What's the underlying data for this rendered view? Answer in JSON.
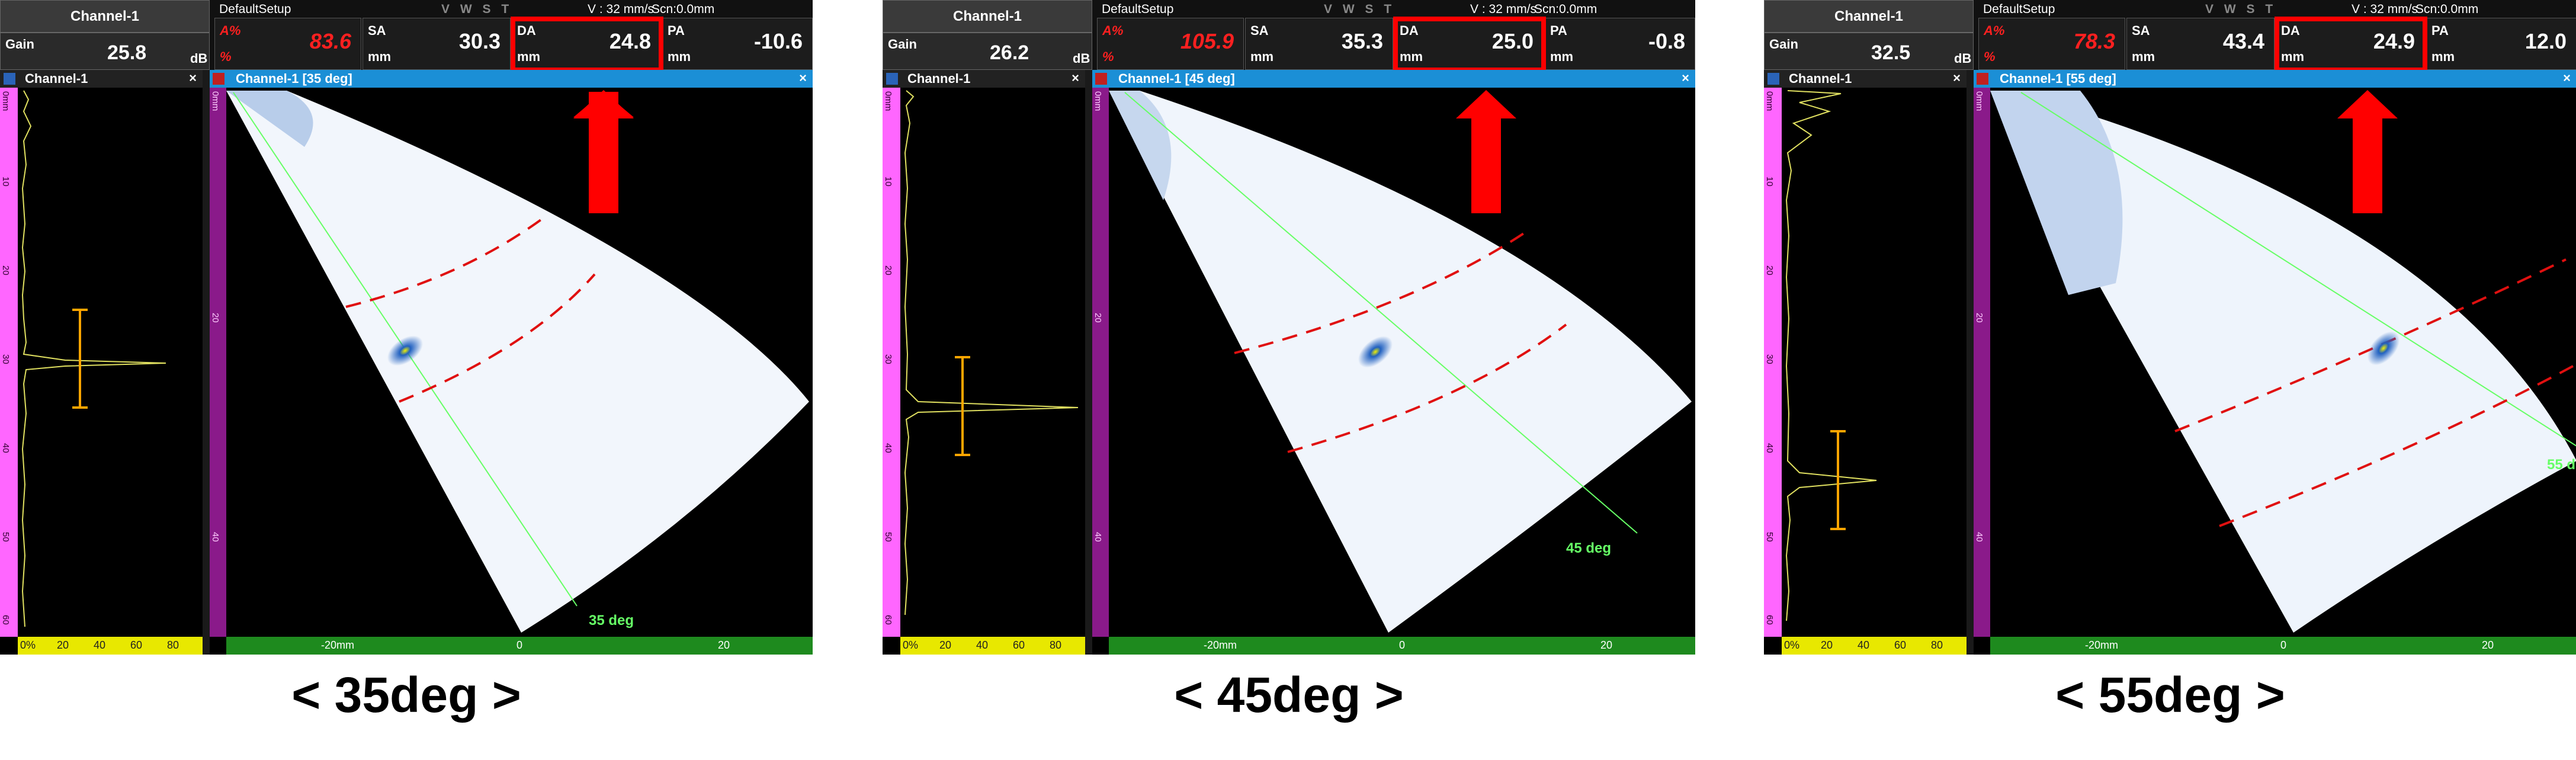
{
  "panels": [
    {
      "channel": "Channel-1",
      "gain_label": "Gain",
      "gain": "25.8",
      "gain_unit": "dB",
      "setup": "DefaultSetup",
      "vwst": "V W S T",
      "velocity": "V : 32 mm/s",
      "scan": "Scn:0.0mm",
      "ap_label": "A%",
      "ap_unit": "%",
      "ap_value": "83.6",
      "sa_label": "SA",
      "sa_unit": "mm",
      "sa_value": "30.3",
      "da_label": "DA",
      "da_unit": "mm",
      "da_value": "24.8",
      "pa_label": "PA",
      "pa_unit": "mm",
      "pa_value": "-10.6",
      "ascan_title": "Channel-1",
      "sector_title": "Channel-1 [35 deg]",
      "angle_label": "35 deg",
      "caption": "< 35deg >",
      "ruler_labels": [
        "0mm",
        "10",
        "20",
        "30",
        "40",
        "50",
        "60"
      ],
      "ascan_scale": [
        "0%",
        "20",
        "40",
        "60",
        "80"
      ],
      "sector_ruler": [
        "0mm",
        "20",
        "40"
      ],
      "gscale": [
        "-20mm",
        "0",
        "20"
      ]
    },
    {
      "channel": "Channel-1",
      "gain_label": "Gain",
      "gain": "26.2",
      "gain_unit": "dB",
      "setup": "DefaultSetup",
      "vwst": "V W S T",
      "velocity": "V : 32 mm/s",
      "scan": "Scn:0.0mm",
      "ap_label": "A%",
      "ap_unit": "%",
      "ap_value": "105.9",
      "sa_label": "SA",
      "sa_unit": "mm",
      "sa_value": "35.3",
      "da_label": "DA",
      "da_unit": "mm",
      "da_value": "25.0",
      "pa_label": "PA",
      "pa_unit": "mm",
      "pa_value": "-0.8",
      "ascan_title": "Channel-1",
      "sector_title": "Channel-1 [45 deg]",
      "angle_label": "45 deg",
      "caption": "< 45deg >",
      "ruler_labels": [
        "0mm",
        "10",
        "20",
        "30",
        "40",
        "50",
        "60"
      ],
      "ascan_scale": [
        "0%",
        "20",
        "40",
        "60",
        "80"
      ],
      "sector_ruler": [
        "0mm",
        "20",
        "40"
      ],
      "gscale": [
        "-20mm",
        "0",
        "20"
      ]
    },
    {
      "channel": "Channel-1",
      "gain_label": "Gain",
      "gain": "32.5",
      "gain_unit": "dB",
      "setup": "DefaultSetup",
      "vwst": "V W S T",
      "velocity": "V : 32 mm/s",
      "scan": "Scn:0.0mm",
      "ap_label": "A%",
      "ap_unit": "%",
      "ap_value": "78.3",
      "sa_label": "SA",
      "sa_unit": "mm",
      "sa_value": "43.4",
      "da_label": "DA",
      "da_unit": "mm",
      "da_value": "24.9",
      "pa_label": "PA",
      "pa_unit": "mm",
      "pa_value": "12.0",
      "ascan_title": "Channel-1",
      "sector_title": "Channel-1 [55 deg]",
      "angle_label": "55 d",
      "caption": "< 55deg >",
      "ruler_labels": [
        "0mm",
        "10",
        "20",
        "30",
        "40",
        "50",
        "60"
      ],
      "ascan_scale": [
        "0%",
        "20",
        "40",
        "60",
        "80"
      ],
      "sector_ruler": [
        "0mm",
        "20",
        "40"
      ],
      "gscale": [
        "-20mm",
        "0",
        "20"
      ]
    }
  ],
  "colors": {
    "highlight": "#ff0000",
    "arrow": "#ff0000",
    "amplitude_red": "#ff2020",
    "title_blue": "#1b8fd6",
    "ruler_magenta": "#ff66ff",
    "scale_green": "#1e8a1e",
    "scale_yellow": "#e8e800",
    "beam_line": "#66ff66",
    "gate_dash": "#e01010",
    "cursor_orange": "#ffa500",
    "signal_yellow": "#e0e060"
  }
}
